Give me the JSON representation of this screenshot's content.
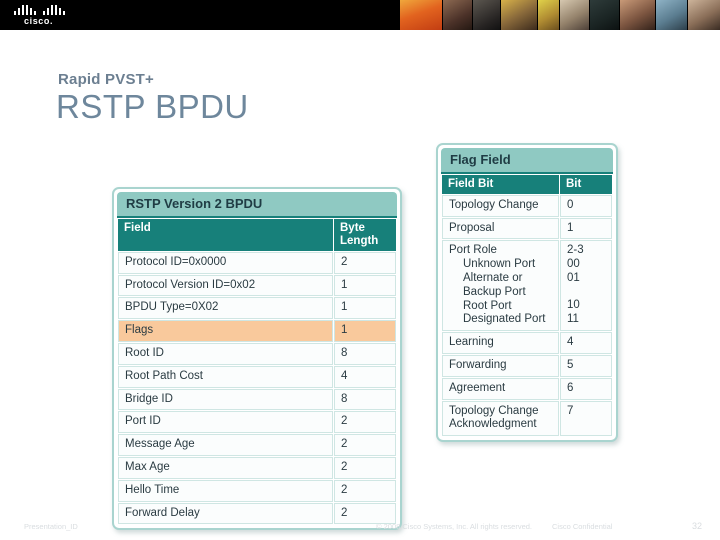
{
  "header": {
    "logo_wordmark": "cisco.",
    "logo_name": "cisco-logo",
    "photo_strip_alt": "people-photo-strip"
  },
  "title": {
    "eyebrow": "Rapid PVST+",
    "heading": "RSTP BPDU"
  },
  "bpdu_table": {
    "title": "RSTP Version 2 BPDU",
    "columns": [
      "Field",
      "Byte Length"
    ],
    "rows": [
      {
        "field": "Protocol ID=0x0000",
        "bytes": "2",
        "highlight": false
      },
      {
        "field": "Protocol Version ID=0x02",
        "bytes": "1",
        "highlight": false
      },
      {
        "field": "BPDU Type=0X02",
        "bytes": "1",
        "highlight": false
      },
      {
        "field": "Flags",
        "bytes": "1",
        "highlight": true
      },
      {
        "field": "Root ID",
        "bytes": "8",
        "highlight": false
      },
      {
        "field": "Root Path Cost",
        "bytes": "4",
        "highlight": false
      },
      {
        "field": "Bridge ID",
        "bytes": "8",
        "highlight": false
      },
      {
        "field": "Port ID",
        "bytes": "2",
        "highlight": false
      },
      {
        "field": "Message Age",
        "bytes": "2",
        "highlight": false
      },
      {
        "field": "Max Age",
        "bytes": "2",
        "highlight": false
      },
      {
        "field": "Hello Time",
        "bytes": "2",
        "highlight": false
      },
      {
        "field": "Forward Delay",
        "bytes": "2",
        "highlight": false
      }
    ]
  },
  "flag_table": {
    "title": "Flag Field",
    "columns": [
      "Field Bit",
      "Bit"
    ],
    "rows": [
      {
        "field": "Topology Change",
        "bit": "0"
      },
      {
        "field": "Proposal",
        "bit": "1"
      },
      {
        "field": "Port Role",
        "bit": "2-3"
      },
      {
        "field": "Learning",
        "bit": "4"
      },
      {
        "field": "Forwarding",
        "bit": "5"
      },
      {
        "field": "Agreement",
        "bit": "6"
      },
      {
        "field": "Topology Change Acknowledgment",
        "bit": "7"
      }
    ],
    "port_role_subitems": [
      {
        "label": "Unknown Port",
        "bits": "00"
      },
      {
        "label": "Alternate or Backup Port",
        "bits": "01"
      },
      {
        "label": "Root Port",
        "bits": "10"
      },
      {
        "label": "Designated Port",
        "bits": "11"
      }
    ]
  },
  "footer": {
    "presentation_id": "Presentation_ID",
    "copyright": "© 2008 Cisco Systems, Inc. All rights reserved.",
    "confidential": "Cisco Confidential",
    "page_number": "32"
  },
  "colors": {
    "header_bar": "#000000",
    "title_text": "#6e879c",
    "eyebrow_text": "#6c7f91",
    "table_header_teal": "#17807a",
    "table_title_teal": "#8fc9c2",
    "table_border": "#a9d4cf",
    "highlight_peach": "#f9c99c"
  }
}
